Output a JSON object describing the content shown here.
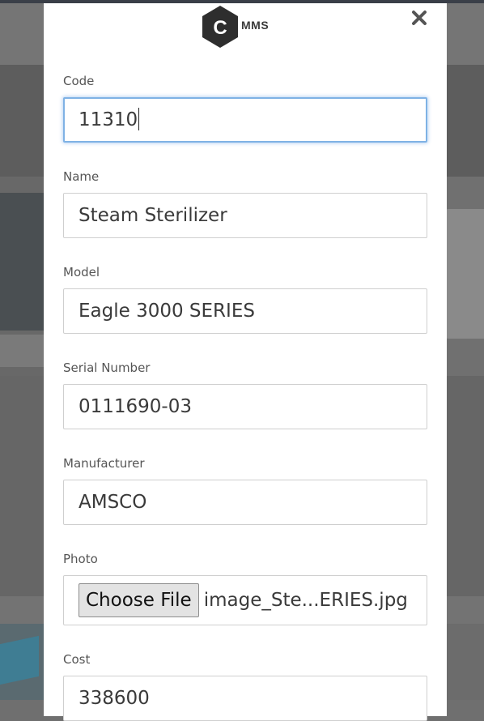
{
  "brand": {
    "logo_letter": "C",
    "logo_text": "MMS"
  },
  "modal": {
    "close_icon": "close-x-icon"
  },
  "form": {
    "code": {
      "label": "Code",
      "value": "11310"
    },
    "name": {
      "label": "Name",
      "value": "Steam Sterilizer"
    },
    "model": {
      "label": "Model",
      "value": "Eagle 3000 SERIES"
    },
    "serial": {
      "label": "Serial Number",
      "value": "0111690-03"
    },
    "manufacturer": {
      "label": "Manufacturer",
      "value": "AMSCO"
    },
    "photo": {
      "label": "Photo",
      "button_label": "Choose File",
      "file_name": "image_Ste...ERIES.jpg"
    },
    "cost": {
      "label": "Cost",
      "value": "338600"
    }
  },
  "colors": {
    "logo_hex": "#2e2e2e",
    "focus_border": "#7fb2e5",
    "input_border": "#cfcfcf",
    "overlay": "#6f6f6f"
  }
}
